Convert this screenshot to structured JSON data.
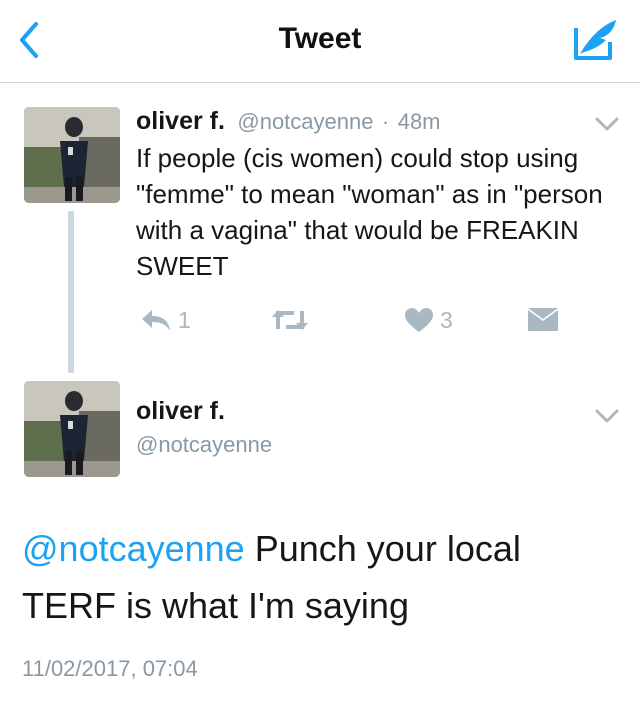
{
  "header": {
    "title": "Tweet"
  },
  "colors": {
    "accent": "#1da1f2",
    "muted": "#8899a6",
    "action": "#aab8c2"
  },
  "icons": {
    "back": "chevron-left-icon",
    "compose": "compose-feather-icon",
    "menu": "chevron-down-icon",
    "reply": "reply-icon",
    "retweet": "retweet-icon",
    "like": "heart-icon",
    "dm": "envelope-icon"
  },
  "tweet1": {
    "name": "oliver f.",
    "handle": "@notcayenne",
    "separator": "·",
    "time": "48m",
    "text": "If people (cis women) could stop using \"femme\" to mean \"woman\" as in \"person with a vagina\" that would be FREAKIN SWEET",
    "actions": {
      "replies": "1",
      "likes": "3"
    }
  },
  "tweet2": {
    "name": "oliver f.",
    "handle": "@notcayenne",
    "mention": "@notcayenne",
    "text": " Punch your local TERF is what I'm saying",
    "timestamp": "11/02/2017, 07:04"
  }
}
